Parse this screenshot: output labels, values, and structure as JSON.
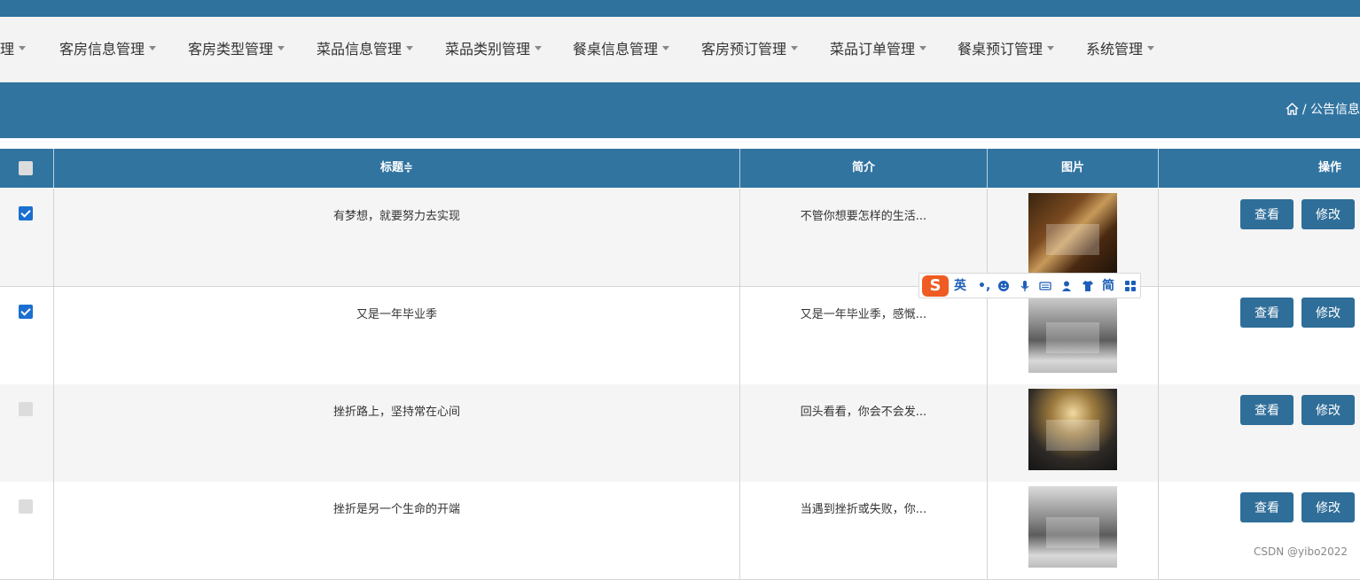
{
  "nav": {
    "items": [
      "理",
      "客房信息管理",
      "客房类型管理",
      "菜品信息管理",
      "菜品类别管理",
      "餐桌信息管理",
      "客房预订管理",
      "菜品订单管理",
      "餐桌预订管理",
      "系统管理"
    ]
  },
  "breadcrumb": {
    "separator": "/",
    "current": "公告信息"
  },
  "table": {
    "headers": {
      "title": "标题",
      "sort_glyph": "≑",
      "summary": "简介",
      "image": "图片",
      "actions": "操作"
    },
    "rows": [
      {
        "checked": true,
        "title": "有梦想，就要努力去实现",
        "summary": "不管你想要怎样的生活...",
        "image": "bedroom-photo-warm",
        "view": "查看",
        "edit": "修改"
      },
      {
        "checked": true,
        "title": "又是一年毕业季",
        "summary": "又是一年毕业季，感慨...",
        "image": "bedroom-photo-gray",
        "view": "查看",
        "edit": "修改"
      },
      {
        "checked": false,
        "title": "挫折路上，坚持常在心间",
        "summary": "回头看看，你会不会发...",
        "image": "bedroom-photo-night",
        "view": "查看",
        "edit": "修改"
      },
      {
        "checked": false,
        "title": "挫折是另一个生命的开端",
        "summary": "当遇到挫折或失败，你...",
        "image": "bedroom-photo-gray",
        "view": "查看",
        "edit": "修改"
      }
    ]
  },
  "ime": {
    "logo": "S",
    "lang": "英",
    "punct": "•,",
    "script": "简"
  },
  "watermark": "CSDN @yibo2022",
  "colors": {
    "primary": "#3174a0",
    "button": "#2f6e99",
    "nav_bg": "#f3f3f3",
    "checkbox": "#1a6fd0",
    "ime_logo": "#ef5b22"
  }
}
